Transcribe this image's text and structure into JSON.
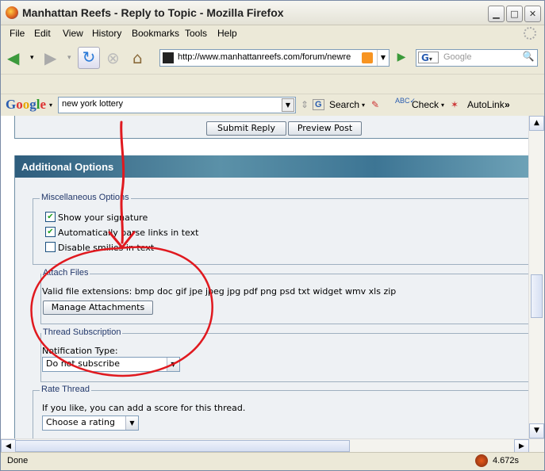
{
  "window": {
    "title": "Manhattan Reefs - Reply to Topic - Mozilla Firefox"
  },
  "menu": [
    "File",
    "Edit",
    "View",
    "History",
    "Bookmarks",
    "Tools",
    "Help"
  ],
  "nav": {
    "url": "http://www.manhattanreefs.com/forum/newre",
    "search_placeholder": "Google",
    "search_engine": "G"
  },
  "google_toolbar": {
    "logo": "Google",
    "query": "new york lottery",
    "search_label": "Search",
    "check_label": "Check",
    "autolink_label": "AutoLink",
    "more": "»"
  },
  "page": {
    "submit_label": "Submit Reply",
    "preview_label": "Preview Post",
    "section_title": "Additional Options",
    "misc": {
      "legend": "Miscellaneous Options",
      "options": [
        {
          "label": "Show your signature",
          "checked": true
        },
        {
          "label": "Automatically parse links in text",
          "checked": true
        },
        {
          "label": "Disable smilies in text",
          "checked": false
        }
      ]
    },
    "attach": {
      "legend": "Attach Files",
      "extensions_text": "Valid file extensions: bmp doc gif jpe jpeg jpg pdf png psd txt widget wmv xls zip",
      "manage_label": "Manage Attachments"
    },
    "subscription": {
      "legend": "Thread Subscription",
      "type_label": "Notification Type:",
      "selected": "Do not subscribe"
    },
    "rate": {
      "legend": "Rate Thread",
      "prompt": "If you like, you can add a score for this thread.",
      "selected": "Choose a rating"
    }
  },
  "status": {
    "text": "Done",
    "timing": "4.672s"
  },
  "annotation_color": "#e0191f"
}
